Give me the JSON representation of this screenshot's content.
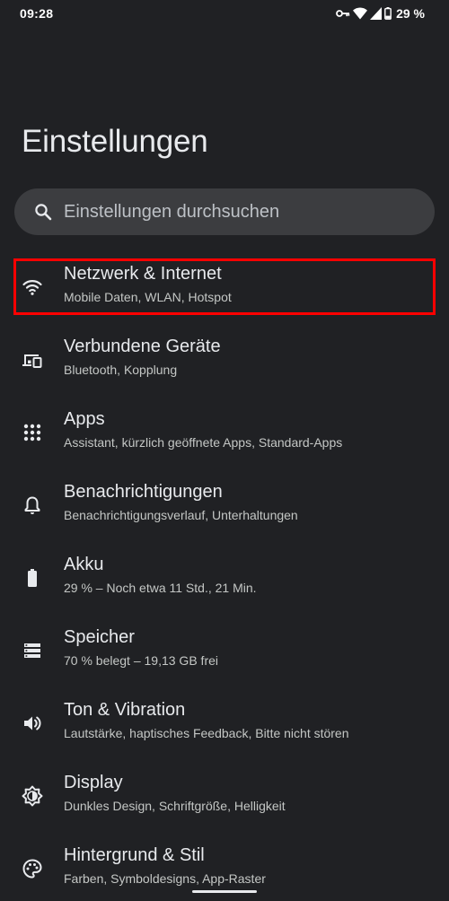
{
  "status_bar": {
    "time": "09:28",
    "battery_text": "29 %",
    "icons": [
      "vpn-key-icon",
      "wifi-icon",
      "signal-icon",
      "battery-icon"
    ]
  },
  "page": {
    "title": "Einstellungen"
  },
  "search": {
    "placeholder": "Einstellungen durchsuchen",
    "icon": "search-icon"
  },
  "items": [
    {
      "title": "Netzwerk & Internet",
      "subtitle": "Mobile Daten, WLAN, Hotspot",
      "icon": "wifi-icon"
    },
    {
      "title": "Verbundene Geräte",
      "subtitle": "Bluetooth, Kopplung",
      "icon": "connected-devices-icon"
    },
    {
      "title": "Apps",
      "subtitle": "Assistant, kürzlich geöffnete Apps, Standard-Apps",
      "icon": "apps-grid-icon"
    },
    {
      "title": "Benachrichtigungen",
      "subtitle": "Benachrichtigungsverlauf, Unterhaltungen",
      "icon": "bell-icon"
    },
    {
      "title": "Akku",
      "subtitle": "29 % – Noch etwa 11 Std., 21 Min.",
      "icon": "battery-icon"
    },
    {
      "title": "Speicher",
      "subtitle": "70 % belegt – 19,13 GB frei",
      "icon": "storage-icon"
    },
    {
      "title": "Ton & Vibration",
      "subtitle": "Lautstärke, haptisches Feedback, Bitte nicht stören",
      "icon": "volume-icon"
    },
    {
      "title": "Display",
      "subtitle": "Dunkles Design, Schriftgröße, Helligkeit",
      "icon": "brightness-icon"
    },
    {
      "title": "Hintergrund & Stil",
      "subtitle": "Farben, Symboldesigns, App-Raster",
      "icon": "palette-icon"
    }
  ],
  "highlight": {
    "target": "Netzwerk & Internet",
    "color": "#ff0000"
  },
  "colors": {
    "background": "#202124",
    "search_background": "#3c3d40",
    "text_primary": "#e8eaed",
    "text_secondary": "#c4c7c5"
  }
}
